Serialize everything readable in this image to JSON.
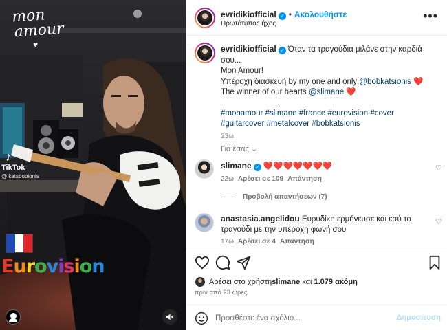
{
  "media": {
    "overlay_lines": [
      "mon",
      "amour"
    ],
    "tiktok_label": "TikTok",
    "tiktok_handle": "@ katsbobionis",
    "eurovision_letters": [
      "E",
      "u",
      "r",
      "o",
      "v",
      "i",
      "s",
      "i",
      "o",
      "n"
    ],
    "eurovision_colors": [
      "#e23b2e",
      "#f08c1c",
      "#f3d22a",
      "#3cae4d",
      "#2a86d8",
      "#7c3fbf",
      "#e2336e",
      "#f08c1c",
      "#3cae4d",
      "#2a86d8"
    ],
    "flag_colors": [
      "#1f4bb5",
      "#ffffff",
      "#e0252b"
    ],
    "avatar_icon": "user-icon",
    "mute_icon": "speaker-muted-icon"
  },
  "header": {
    "username": "evridikiofficial",
    "follow_label": "Ακολουθήστε",
    "subtitle": "Πρωτότυπος ήχος",
    "more_icon": "more-horizontal-icon"
  },
  "caption": {
    "username": "evridikiofficial",
    "first_line": "Όταν τα τραγούδια μιλάνε στην καρδιά",
    "second_line": "σου...",
    "line3": "Mon Amour!",
    "line4_text": "Υπέροχη διασκευή by my one and only ",
    "line4_mention": "@bobkatsionis",
    "line4_emoji": "❤️",
    "line5_text": "The winner of our hearts ",
    "line5_mention": "@slimane",
    "line5_emoji": "❤️",
    "hashtags_line1": "#monamour #slimane #france #eurovision #cover",
    "hashtags_line2": "#guitarcover #metalcover #bobkatsionis",
    "age": "23ω",
    "for_you": "Για εσάς"
  },
  "comments": [
    {
      "username": "slimane",
      "text": "❤️❤️❤️❤️❤️❤️❤️",
      "age": "22ω",
      "likes": "Αρέσει σε 109",
      "reply": "Απάντηση"
    },
    {
      "username": "anastasia.angelidou",
      "text": "Ευρυδίκη ερμήνευσε και εσύ το τραγούδι με την υπέροχη φωνή σου",
      "age": "17ω",
      "likes": "Αρέσει σε 4",
      "reply": "Απάντηση"
    }
  ],
  "view_replies": "Προβολή απαντήσεων (7)",
  "likes": {
    "prefix": "Αρέσει στο χρήστη ",
    "user": "slimane",
    "middle": " και ",
    "count": "1.079 ακόμη"
  },
  "posted": "πριν από 23 ώρες",
  "add_comment": {
    "placeholder": "Προσθέστε ένα σχόλιο...",
    "post_label": "Δημοσίευση"
  },
  "colors": {
    "accent": "#0095f6",
    "link": "#00376b",
    "heart": "#ed4956"
  }
}
